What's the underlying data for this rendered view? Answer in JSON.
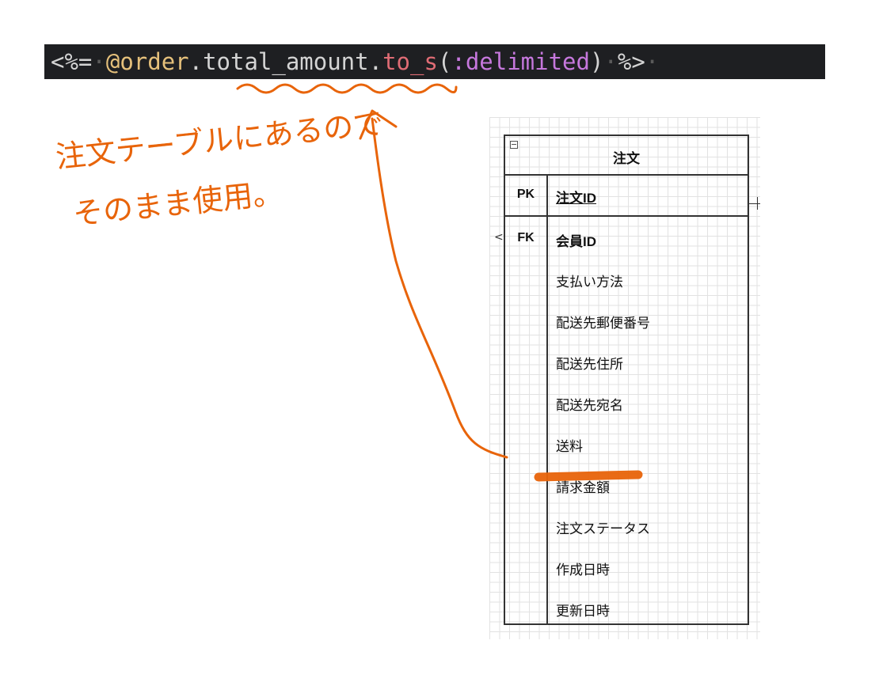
{
  "code": {
    "tokens": [
      {
        "text": "<%=",
        "color": "#d4d4d4"
      },
      {
        "text": "·",
        "color": "#5a5a5a"
      },
      {
        "text": "@order",
        "color": "#e5c07b"
      },
      {
        "text": ".total_amount.",
        "color": "#d4d4d4"
      },
      {
        "text": "to_s",
        "color": "#e06c75"
      },
      {
        "text": "(",
        "color": "#d4d4d4"
      },
      {
        "text": ":delimited",
        "color": "#c678dd"
      },
      {
        "text": ")",
        "color": "#d4d4d4"
      },
      {
        "text": "·",
        "color": "#5a5a5a"
      },
      {
        "text": "%>",
        "color": "#d4d4d4"
      },
      {
        "text": "·",
        "color": "#5a5a5a"
      }
    ]
  },
  "annotation": {
    "line1": "注文テーブルにあるので",
    "line2": "そのまま使用。",
    "color": "#e8640a"
  },
  "entity": {
    "title": "注文",
    "pk_label": "PK",
    "fk_label": "FK",
    "pk_field": "注文ID",
    "fk_field": "会員ID",
    "attributes": [
      "支払い方法",
      "配送先郵便番号",
      "配送先住所",
      "配送先宛名",
      "送料",
      "請求金額",
      "注文ステータス",
      "作成日時",
      "更新日時"
    ],
    "highlighted_attribute": "請求金額"
  }
}
